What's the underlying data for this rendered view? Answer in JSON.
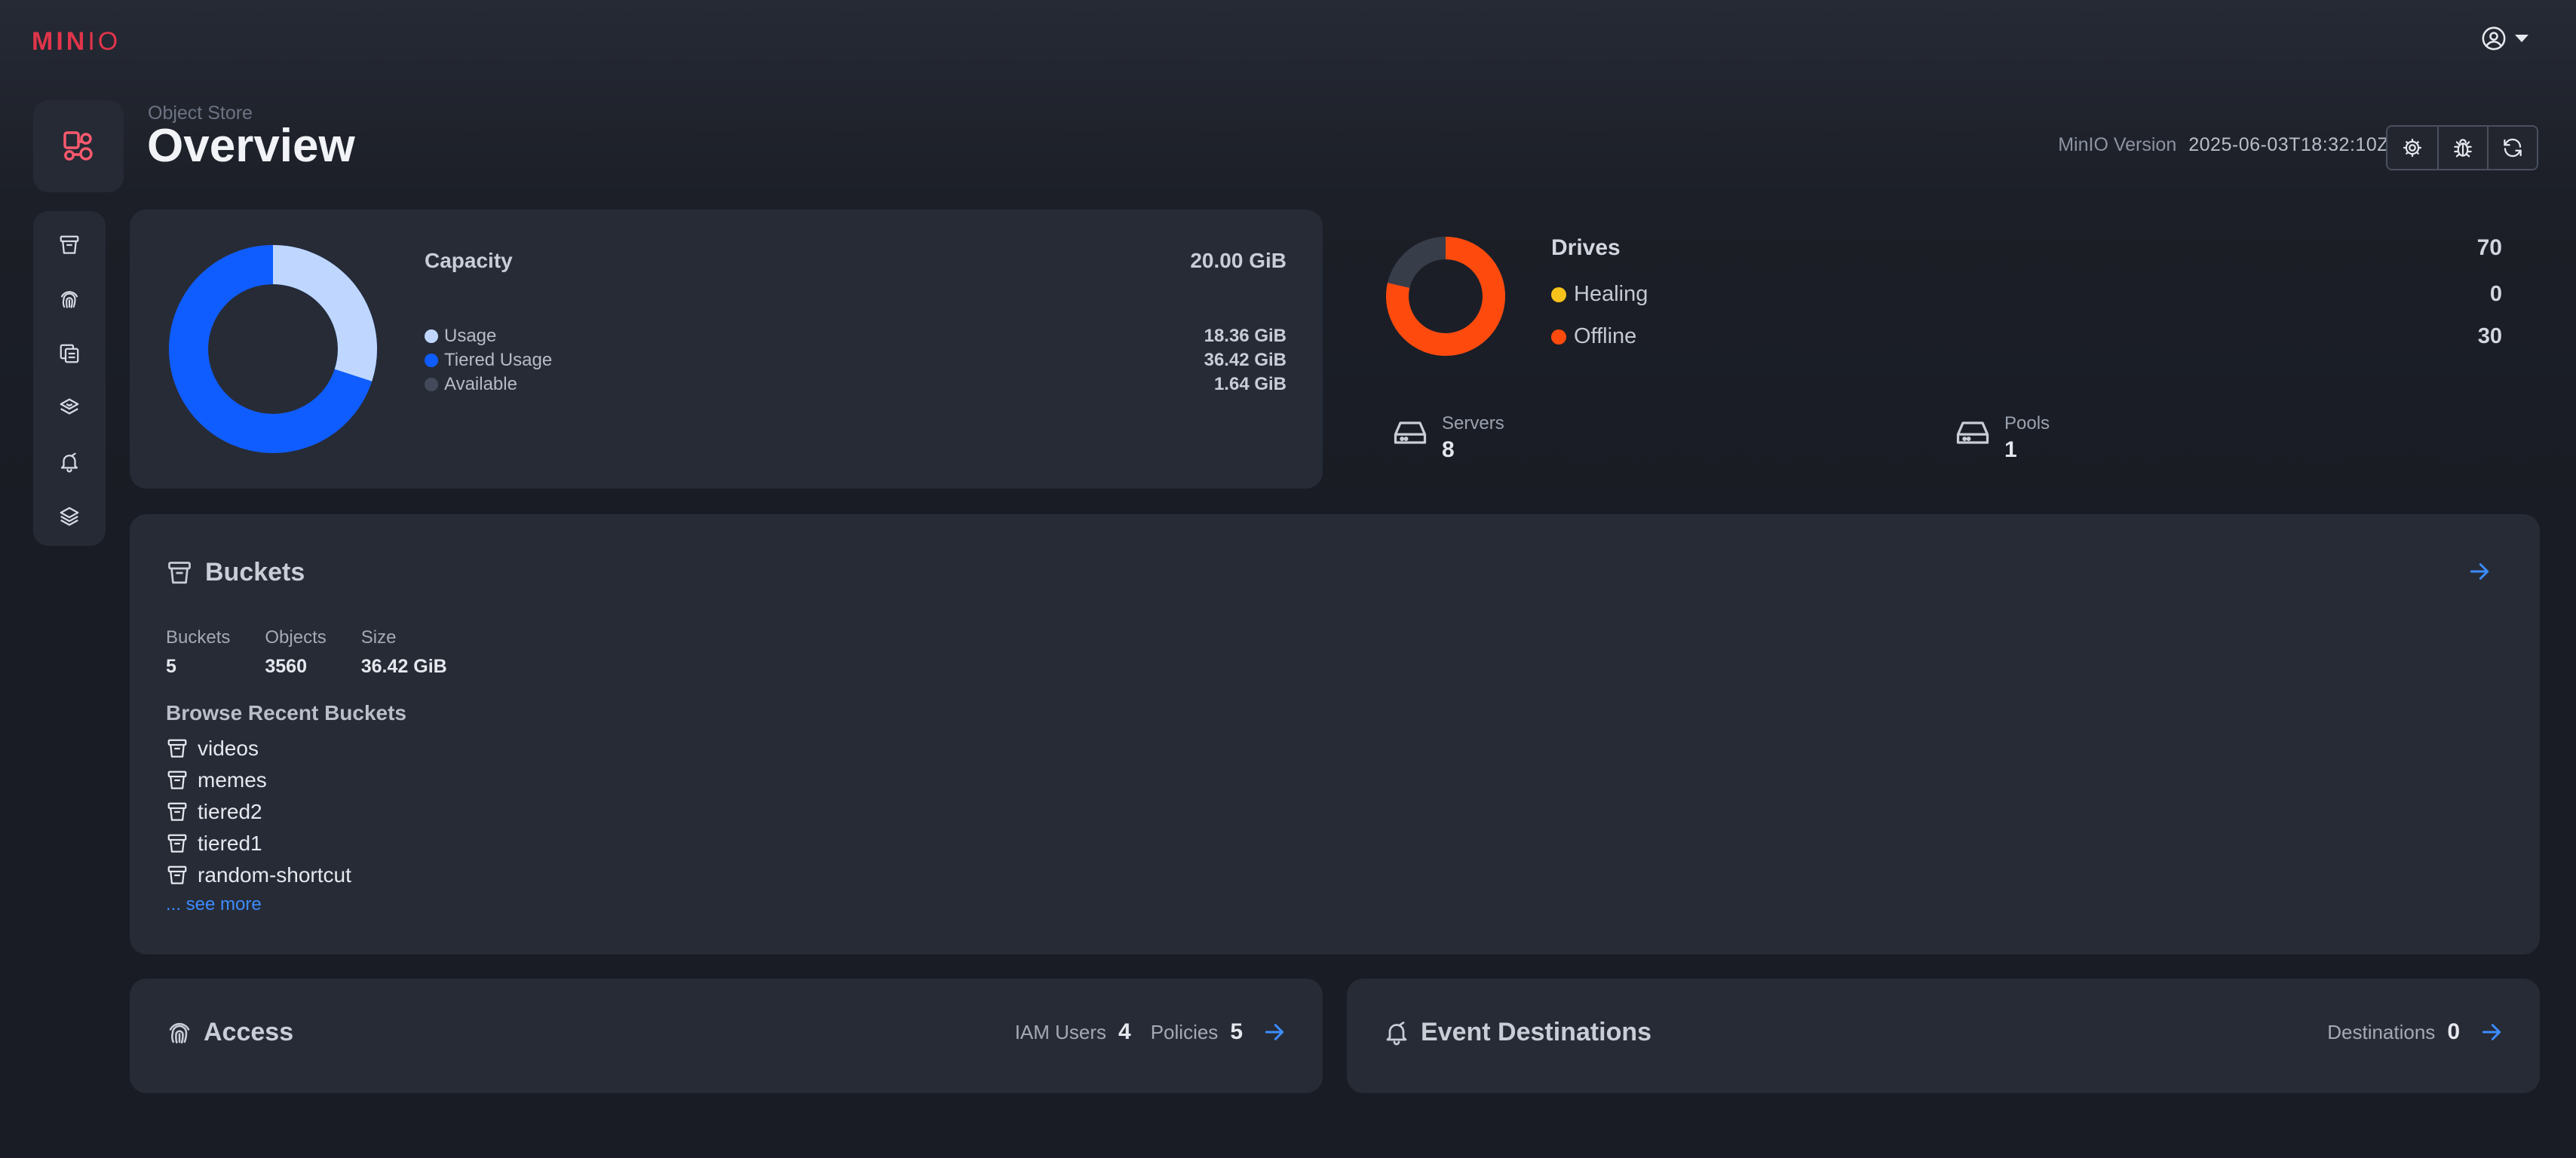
{
  "app": {
    "logo_bold": "MIN",
    "logo_thin": "IO"
  },
  "header": {
    "breadcrumb": "Object Store",
    "title": "Overview",
    "version_label": "MinIO Version",
    "version_value": "2025-06-03T18:32:10Z"
  },
  "toolbar": {
    "icons": [
      "gear-icon",
      "bug-icon",
      "refresh-icon"
    ]
  },
  "sidebar": {
    "icons": [
      "bucket-icon",
      "fingerprint-icon",
      "copy-icon",
      "layers-stack-icon",
      "bell-icon",
      "layers-icon"
    ]
  },
  "capacity": {
    "title": "Capacity",
    "total": "20.00 GiB",
    "legend": [
      {
        "label": "Usage",
        "value": "18.36 GiB",
        "color": "#bfd7ff",
        "share": 0.3
      },
      {
        "label": "Tiered Usage",
        "value": "36.42 GiB",
        "color": "#0f5cff",
        "share": 0.7
      },
      {
        "label": "Available",
        "value": "1.64 GiB",
        "color": "#444a5a",
        "share": 0.0
      }
    ]
  },
  "drives": {
    "title": "Drives",
    "total": "70",
    "healing_label": "Healing",
    "healing_value": "0",
    "offline_label": "Offline",
    "offline_value": "30",
    "colors": {
      "healing": "#f6c21b",
      "offline": "#ff4a0e",
      "online": "#383d4a"
    },
    "online_share": 0.214
  },
  "servers": {
    "label": "Servers",
    "value": "8"
  },
  "pools": {
    "label": "Pools",
    "value": "1"
  },
  "buckets": {
    "title": "Buckets",
    "stats": [
      {
        "label": "Buckets",
        "value": "5"
      },
      {
        "label": "Objects",
        "value": "3560"
      },
      {
        "label": "Size",
        "value": "36.42 GiB"
      }
    ],
    "recent_title": "Browse Recent Buckets",
    "recent": [
      "videos",
      "memes",
      "tiered2",
      "tiered1",
      "random-shortcut"
    ],
    "see_more": "... see more"
  },
  "access": {
    "title": "Access",
    "iam_label": "IAM Users",
    "iam_value": "4",
    "policies_label": "Policies",
    "policies_value": "5"
  },
  "events": {
    "title": "Event Destinations",
    "destinations_label": "Destinations",
    "destinations_value": "0"
  },
  "colors": {
    "accent": "#3d8cff",
    "brand": "#e0354b"
  }
}
